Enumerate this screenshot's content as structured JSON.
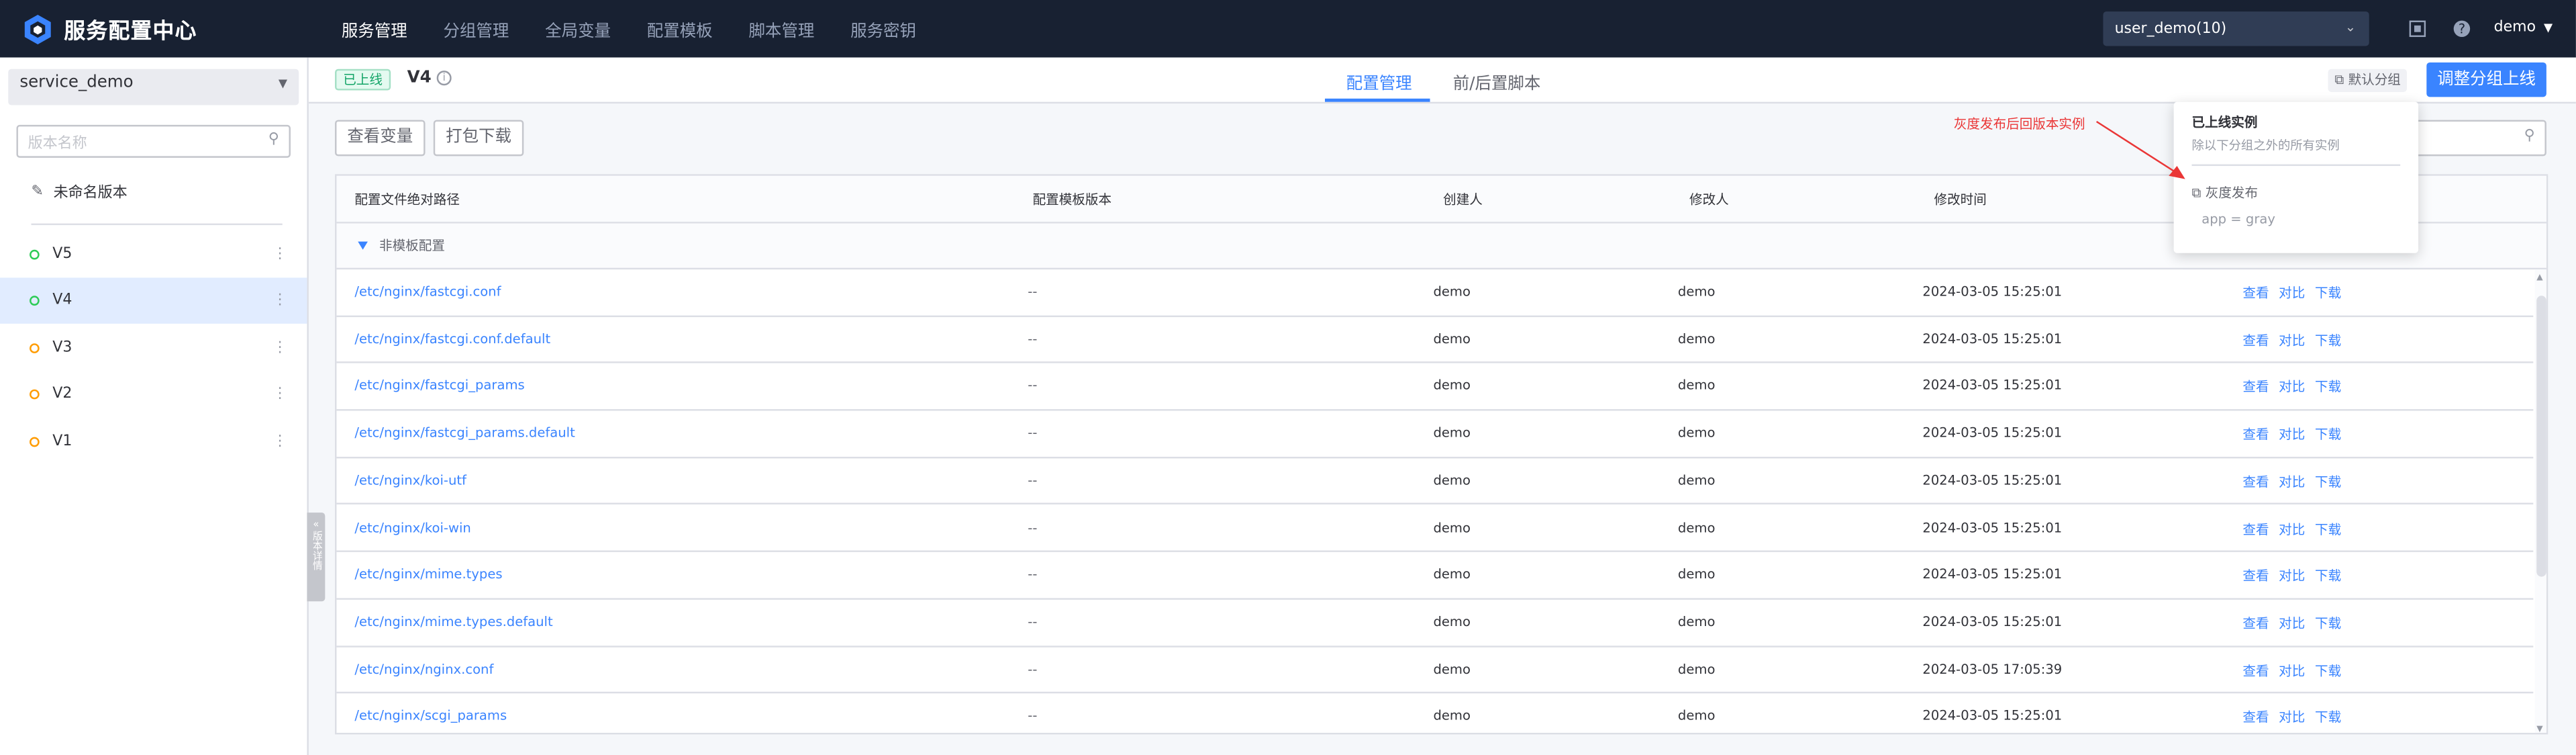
{
  "app": {
    "title": "服务配置中心"
  },
  "nav": {
    "items": [
      "服务管理",
      "分组管理",
      "全局变量",
      "配置模板",
      "脚本管理",
      "服务密钥"
    ],
    "active_index": 0
  },
  "header": {
    "business": "user_demo(10)",
    "user": "demo"
  },
  "sidebar": {
    "service": "service_demo",
    "search_placeholder": "版本名称",
    "unnamed_version": "未命名版本",
    "versions": [
      {
        "name": "V5",
        "status": "green"
      },
      {
        "name": "V4",
        "status": "green",
        "active": true
      },
      {
        "name": "V3",
        "status": "orange"
      },
      {
        "name": "V2",
        "status": "orange"
      },
      {
        "name": "V1",
        "status": "orange"
      }
    ],
    "collapse_label": "版本详情"
  },
  "version_header": {
    "status": "已上线",
    "name": "V4",
    "tabs": [
      "配置管理",
      "前/后置脚本"
    ],
    "group_tag": "默认分组",
    "primary_button": "调整分组上线"
  },
  "toolbar": {
    "view_vars": "查看变量",
    "download": "打包下载"
  },
  "table": {
    "columns": [
      "配置文件绝对路径",
      "配置模板版本",
      "创建人",
      "修改人",
      "修改时间"
    ],
    "group_label": "非模板配置",
    "rows": [
      {
        "path": "/etc/nginx/fastcgi.conf",
        "tpl": "--",
        "creator": "demo",
        "modifier": "demo",
        "time": "2024-03-05 15:25:01"
      },
      {
        "path": "/etc/nginx/fastcgi.conf.default",
        "tpl": "--",
        "creator": "demo",
        "modifier": "demo",
        "time": "2024-03-05 15:25:01"
      },
      {
        "path": "/etc/nginx/fastcgi_params",
        "tpl": "--",
        "creator": "demo",
        "modifier": "demo",
        "time": "2024-03-05 15:25:01"
      },
      {
        "path": "/etc/nginx/fastcgi_params.default",
        "tpl": "--",
        "creator": "demo",
        "modifier": "demo",
        "time": "2024-03-05 15:25:01"
      },
      {
        "path": "/etc/nginx/koi-utf",
        "tpl": "--",
        "creator": "demo",
        "modifier": "demo",
        "time": "2024-03-05 15:25:01"
      },
      {
        "path": "/etc/nginx/koi-win",
        "tpl": "--",
        "creator": "demo",
        "modifier": "demo",
        "time": "2024-03-05 15:25:01"
      },
      {
        "path": "/etc/nginx/mime.types",
        "tpl": "--",
        "creator": "demo",
        "modifier": "demo",
        "time": "2024-03-05 15:25:01"
      },
      {
        "path": "/etc/nginx/mime.types.default",
        "tpl": "--",
        "creator": "demo",
        "modifier": "demo",
        "time": "2024-03-05 15:25:01"
      },
      {
        "path": "/etc/nginx/nginx.conf",
        "tpl": "--",
        "creator": "demo",
        "modifier": "demo",
        "time": "2024-03-05 17:05:39"
      },
      {
        "path": "/etc/nginx/scgi_params",
        "tpl": "--",
        "creator": "demo",
        "modifier": "demo",
        "time": "2024-03-05 15:25:01"
      }
    ],
    "actions": [
      "查看",
      "对比",
      "下载"
    ]
  },
  "popover": {
    "title": "已上线实例",
    "desc": "除以下分组之外的所有实例",
    "group_name": "灰度发布",
    "rule": "app = gray"
  },
  "annotation": {
    "text": "灰度发布后回版本实例"
  }
}
